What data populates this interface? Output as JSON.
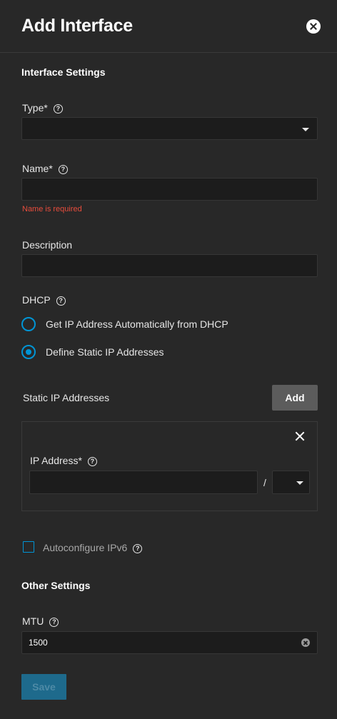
{
  "dialog": {
    "title": "Add Interface",
    "close_icon": "close-circle-icon"
  },
  "interface_settings": {
    "heading": "Interface Settings",
    "type": {
      "label": "Type",
      "required_marker": "*",
      "value": ""
    },
    "name": {
      "label": "Name",
      "required_marker": "*",
      "value": "",
      "error": "Name is required"
    },
    "description": {
      "label": "Description",
      "value": ""
    }
  },
  "dhcp": {
    "label": "DHCP",
    "options": [
      {
        "label": "Get IP Address Automatically from DHCP",
        "selected": false
      },
      {
        "label": "Define Static IP Addresses",
        "selected": true
      }
    ]
  },
  "static_ip": {
    "label": "Static IP Addresses",
    "add_label": "Add",
    "entries": [
      {
        "label": "IP Address",
        "required_marker": "*",
        "address": "",
        "separator": "/",
        "netmask": ""
      }
    ]
  },
  "autoconfigure_ipv6": {
    "label": "Autoconfigure IPv6",
    "checked": false
  },
  "other_settings": {
    "heading": "Other Settings",
    "mtu": {
      "label": "MTU",
      "value": "1500"
    }
  },
  "footer": {
    "save_label": "Save",
    "save_disabled": true
  },
  "colors": {
    "background": "#282828",
    "input_bg": "#1c1c1c",
    "accent": "#0095d5",
    "error": "#e74c3c",
    "add_button": "#5c5c5c",
    "save_button_disabled": "#1e6a8c"
  }
}
